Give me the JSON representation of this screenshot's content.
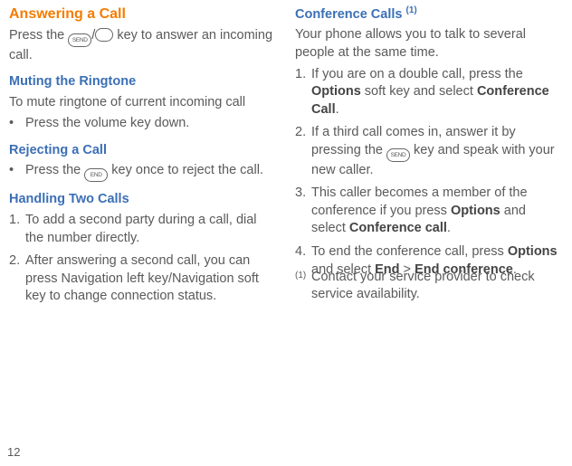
{
  "page_number": "12",
  "left": {
    "h_answering": "Answering a Call",
    "answering_p1_a": "Press the ",
    "answering_p1_b": " key to answer an incoming call.",
    "key_send": "SEND",
    "h_muting": "Muting the Ringtone",
    "muting_p1": "To mute ringtone of current incoming call",
    "muting_b1": "Press the volume key down.",
    "h_rejecting": "Rejecting a Call",
    "rejecting_b1_a": "Press the ",
    "rejecting_b1_b": " key once to reject the call.",
    "key_end": "END",
    "h_handling": "Handling Two Calls",
    "handling_1": "To add a second party during a call, dial the number directly.",
    "handling_2": "After answering a second call, you can press Navigation left key/Navigation soft key to change connection status."
  },
  "right": {
    "h_conf": "Conference Calls ",
    "conf_sup": "(1)",
    "conf_intro": "Your phone allows you to talk to several people at the same time.",
    "conf_1_a": "If you are on a double call, press the ",
    "conf_1_b": "Options",
    "conf_1_c": " soft key and select ",
    "conf_1_d": "Conference Call",
    "conf_1_e": ".",
    "conf_2_a": "If a third call comes in, answer it by pressing the ",
    "conf_2_b": " key and speak with your new caller.",
    "conf_3_a": "This caller becomes a member of the conference if you press ",
    "conf_3_b": "Options",
    "conf_3_c": " and select ",
    "conf_3_d": "Conference call",
    "conf_3_e": ".",
    "conf_4_a": "To end the conference call, press ",
    "conf_4_b": "Options",
    "conf_4_c": " and select ",
    "conf_4_d": "End",
    "conf_4_e": " > ",
    "conf_4_f": "End conference",
    "conf_4_g": ".",
    "footnote_mark": "(1)",
    "footnote_text": "Contact your service provider to check service availability."
  }
}
